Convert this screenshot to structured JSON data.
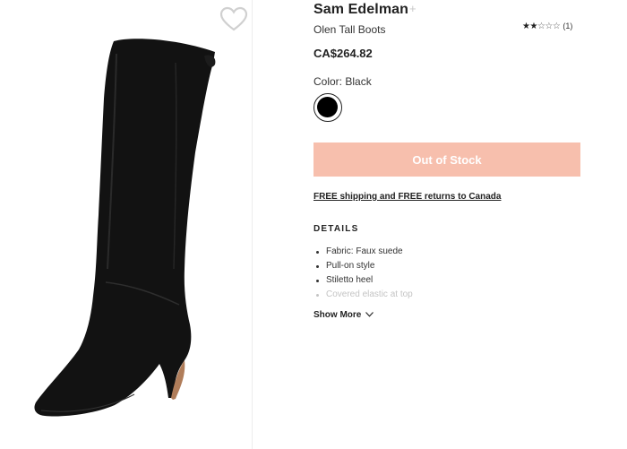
{
  "product": {
    "brand": "Sam Edelman",
    "brand_plus": "+",
    "name": "Olen Tall Boots",
    "price": "CA$264.82",
    "rating": {
      "stars": 2,
      "max_stars": 5,
      "count_text": "(1)"
    },
    "color_label": "Color: Black",
    "swatch_color": "#000000",
    "button_label": "Out of Stock",
    "button_color": "#f7bfad",
    "shipping_text": "FREE shipping and FREE returns to Canada"
  },
  "details": {
    "heading": "DETAILS",
    "items": [
      "Fabric: Faux suede",
      "Pull-on style",
      "Stiletto heel",
      "Covered elastic at top"
    ],
    "show_more": "Show More"
  },
  "icons": {
    "wishlist": "heart-outline-icon",
    "show_more": "chevron-down-icon"
  }
}
